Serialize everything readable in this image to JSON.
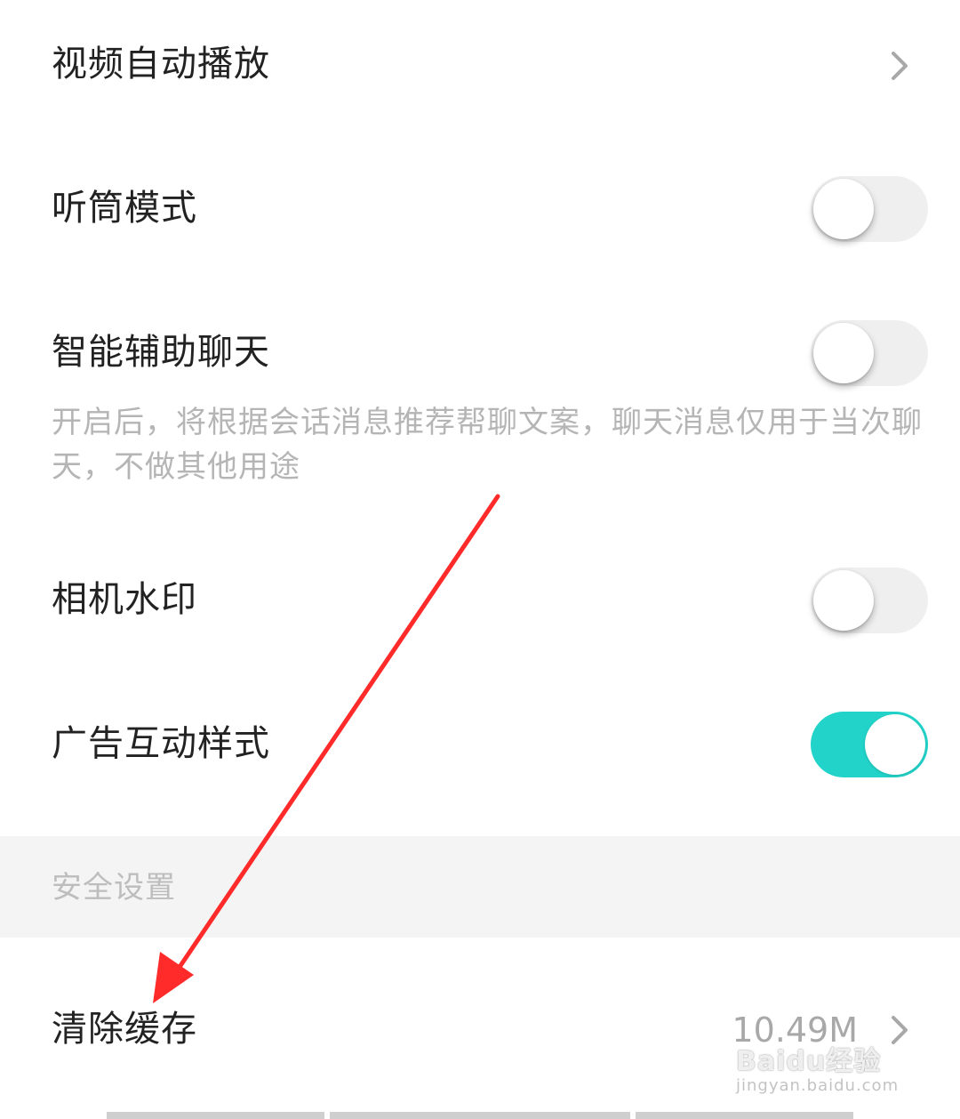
{
  "settings": {
    "video_autoplay": {
      "label": "视频自动播放"
    },
    "earpiece_mode": {
      "label": "听筒模式",
      "enabled": false
    },
    "smart_chat_assist": {
      "label": "智能辅助聊天",
      "enabled": false,
      "description": "开启后，将根据会话消息推荐帮聊文案，聊天消息仅用于当次聊天，不做其他用途"
    },
    "camera_watermark": {
      "label": "相机水印",
      "enabled": false
    },
    "ad_interaction_style": {
      "label": "广告互动样式",
      "enabled": true
    }
  },
  "security_section": {
    "title": "安全设置",
    "clear_cache": {
      "label": "清除缓存",
      "value": "10.49M"
    }
  },
  "watermark": {
    "brand": "Baidu经验",
    "url": "jingyan.baidu.com"
  },
  "colors": {
    "toggle_on": "#22d3c9",
    "toggle_off": "#efefef",
    "annotation_arrow": "#ff2a2a"
  },
  "icons": {
    "row_chevron": "chevron-right-icon"
  }
}
